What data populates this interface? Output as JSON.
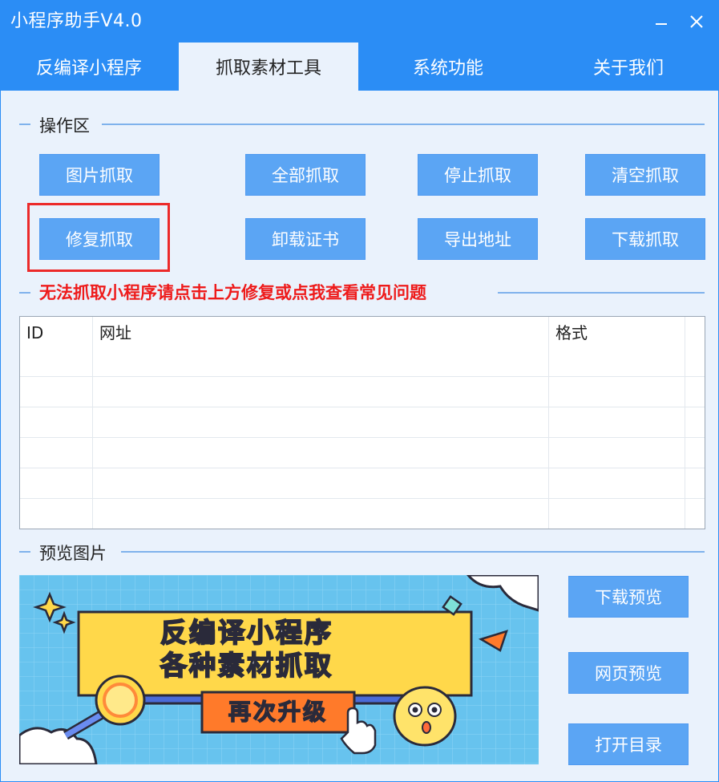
{
  "window": {
    "title": "小程序助手V4.0"
  },
  "tabs": [
    {
      "label": "反编译小程序",
      "active": false
    },
    {
      "label": "抓取素材工具",
      "active": true
    },
    {
      "label": "系统功能",
      "active": false
    },
    {
      "label": "关于我们",
      "active": false
    }
  ],
  "operations": {
    "section_title": "操作区",
    "buttons": [
      "图片抓取",
      "全部抓取",
      "停止抓取",
      "清空抓取",
      "修复抓取",
      "卸载证书",
      "导出地址",
      "下载抓取"
    ]
  },
  "warning": "无法抓取小程序请点击上方修复或点我查看常见问题",
  "table": {
    "columns": [
      "ID",
      "网址",
      "格式"
    ]
  },
  "preview": {
    "section_title": "预览图片",
    "banner_line1": "反编译小程序",
    "banner_line2": "各种素材抓取",
    "banner_badge": "再次升级",
    "buttons": [
      "下载预览",
      "网页预览",
      "打开目录"
    ]
  },
  "colors": {
    "accent": "#2b8df5",
    "button": "#5ba5f4",
    "background": "#eaf2fc",
    "warning": "#ee1b1b",
    "highlight_border": "#ec2a2a"
  }
}
